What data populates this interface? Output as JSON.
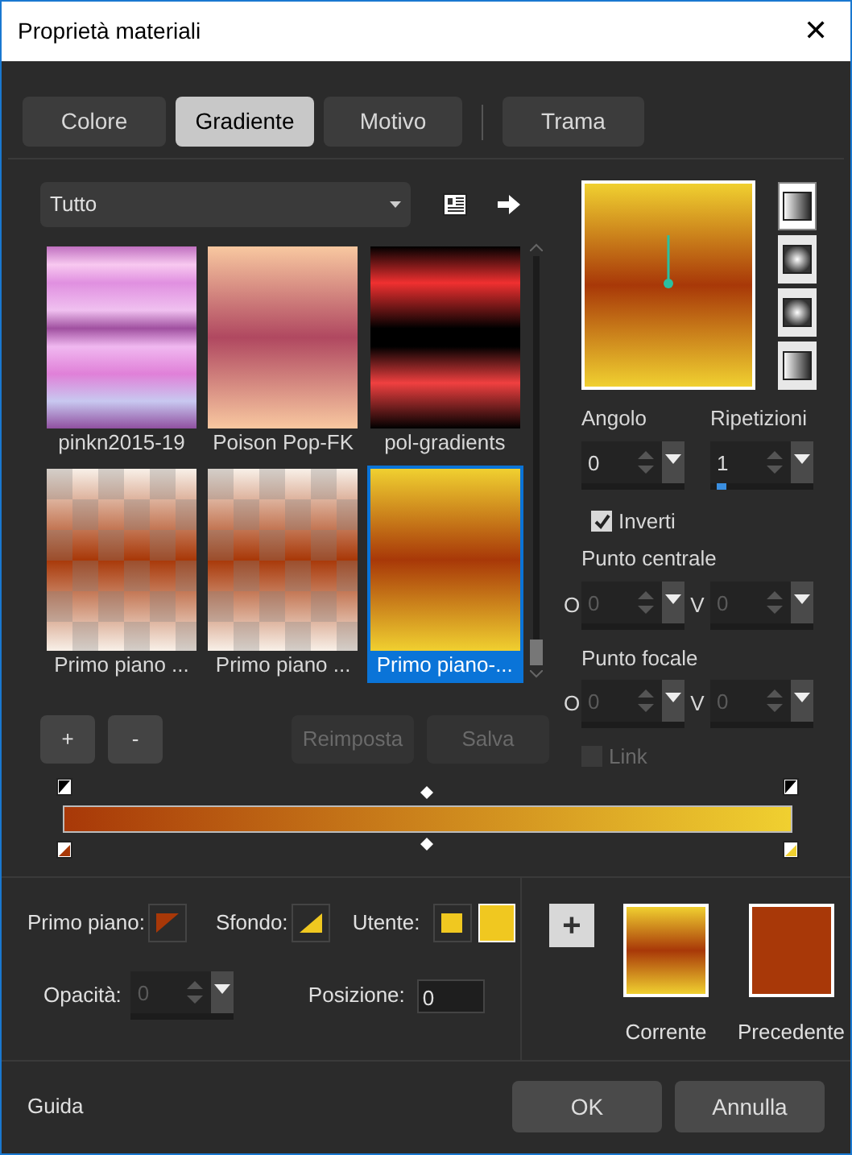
{
  "window": {
    "title": "Proprietà materiali",
    "close": "✕"
  },
  "tabs": [
    {
      "label": "Colore",
      "selected": false
    },
    {
      "label": "Gradiente",
      "selected": true
    },
    {
      "label": "Motivo",
      "selected": false
    },
    {
      "label": "Trama",
      "selected": false
    }
  ],
  "category": {
    "value": "Tutto"
  },
  "presets": [
    {
      "label": "pinkn2015-19",
      "kind": "pink",
      "selected": false
    },
    {
      "label": "Poison Pop-FK",
      "kind": "rose",
      "selected": false
    },
    {
      "label": "pol-gradients",
      "kind": "red",
      "selected": false
    },
    {
      "label": "Primo piano ...",
      "kind": "checker",
      "selected": false
    },
    {
      "label": "Primo piano ...",
      "kind": "checker",
      "selected": false
    },
    {
      "label": "Primo piano-...",
      "kind": "gold",
      "selected": true
    }
  ],
  "preset_buttons": [
    {
      "label": "+",
      "disabled": false
    },
    {
      "label": "-",
      "disabled": false
    },
    {
      "label": "Reimposta",
      "disabled": true
    },
    {
      "label": "Salva",
      "disabled": true
    }
  ],
  "styles": [
    {
      "selected": true
    },
    {
      "selected": false
    },
    {
      "selected": false
    },
    {
      "selected": false
    }
  ],
  "angle": {
    "label": "Angolo",
    "value": "0",
    "disabled": false
  },
  "repeats": {
    "label": "Ripetizioni",
    "value": "1",
    "disabled": false,
    "level": 0.02
  },
  "invert": {
    "label": "Inverti",
    "checked": true,
    "disabled": false
  },
  "center": {
    "label": "Punto centrale",
    "o": {
      "label": "O",
      "value": "0",
      "disabled": true
    },
    "v": {
      "label": "V",
      "value": "0",
      "disabled": true
    }
  },
  "focal": {
    "label": "Punto focale",
    "o": {
      "label": "O",
      "value": "0",
      "disabled": true
    },
    "v": {
      "label": "V",
      "value": "0",
      "disabled": true
    }
  },
  "link": {
    "label": "Link",
    "checked": false,
    "disabled": true
  },
  "swatches": {
    "foreground": "Primo piano:",
    "background": "Sfondo:",
    "user": "Utente:"
  },
  "opacity": {
    "label": "Opacità:",
    "value": "0",
    "disabled": true
  },
  "position": {
    "label": "Posizione:",
    "value": "0"
  },
  "add": "+",
  "current": "Corrente",
  "previous": "Precedente",
  "help": "Guida",
  "ok": "OK",
  "cancel": "Annulla"
}
